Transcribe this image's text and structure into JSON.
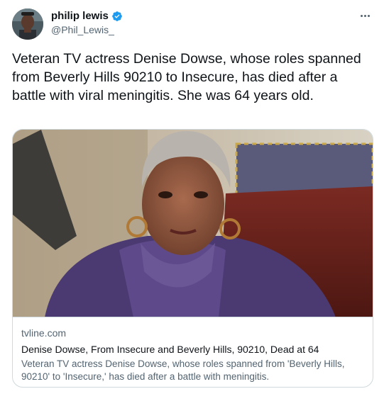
{
  "author": {
    "display_name": "philip lewis",
    "handle": "@Phil_Lewis_",
    "verified": true,
    "avatar_icon": "profile-photo"
  },
  "tweet": {
    "text": "Veteran TV actress Denise Dowse, whose roles spanned from Beverly Hills 90210 to Insecure, has died after a battle with viral meningitis. She was 64 years old."
  },
  "card": {
    "domain": "tvline.com",
    "title": "Denise Dowse, From Insecure and Beverly Hills, 90210, Dead at 64",
    "description": "Veteran TV actress Denise Dowse, whose roles spanned from 'Beverly Hills, 90210' to 'Insecure,' has died after a battle with meningitis."
  },
  "colors": {
    "verified_badge": "#1d9bf0",
    "text_primary": "#0f1419",
    "text_secondary": "#536471",
    "border": "#cfd9de"
  }
}
